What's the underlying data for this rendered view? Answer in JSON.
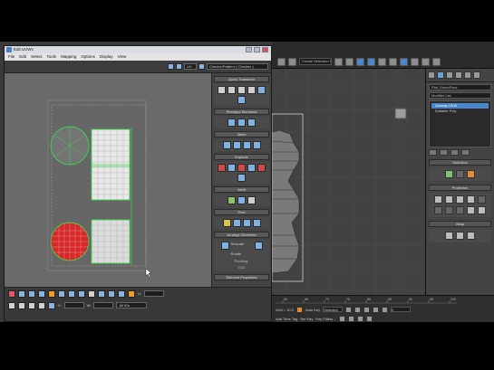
{
  "uvw_editor": {
    "title": "Edit UVWs",
    "menu": [
      "File",
      "Edit",
      "Select",
      "Tools",
      "Mapping",
      "Options",
      "Display",
      "View"
    ],
    "toolbar": {
      "uv_dropdown": "UV",
      "checker_dropdown": "CheckerPattern ( Checker )"
    },
    "rollouts": [
      {
        "id": "quick",
        "title": "Quick Transform"
      },
      {
        "id": "reshape",
        "title": "Reshape Elements"
      },
      {
        "id": "stitch",
        "title": "Stitch"
      },
      {
        "id": "explode",
        "title": "Explode"
      },
      {
        "id": "weld",
        "title": "Weld"
      },
      {
        "id": "peel",
        "title": "Peel"
      },
      {
        "id": "arrange",
        "title": "Arrange Elements",
        "checks": [
          "Rescale",
          "Rotate"
        ],
        "padding_label": "Padding:",
        "padding_value": "0.02"
      },
      {
        "id": "elprops",
        "title": "Element Properties"
      }
    ],
    "bottom": {
      "u_label": "U:",
      "v_label": "V:",
      "w_label": "W:",
      "u_value": "",
      "v_value": "",
      "w_value": "",
      "filter_label": "All IDs"
    }
  },
  "max": {
    "toolbar_dropdown": "Create Selection Se",
    "viewport_label": "",
    "command_panel": {
      "object_name": "Plat_StoneFloor",
      "modifier_list": "Modifier List",
      "stack": [
        {
          "label": "Unwrap UVW",
          "selected": true
        },
        {
          "label": "Editable Poly",
          "selected": false
        }
      ],
      "rollouts": [
        "Selection",
        "Projection",
        "Wrap"
      ]
    },
    "status": {
      "grid_label": "Grid = 10.0",
      "selected_label": "Selected",
      "autokey_label": "Auto Key",
      "setkey_label": "Set Key",
      "keyfilters_label": "Key Filters...",
      "add_time_tag": "Add Time Tag",
      "frame_value": "0"
    },
    "timeline": {
      "ticks": [
        "60",
        "65",
        "70",
        "75",
        "80",
        "85",
        "90",
        "95",
        "100"
      ]
    }
  },
  "colors": {
    "uv_shell_green": "#3fd64a",
    "uv_selected_red": "#d62828",
    "uv_grid_white": "#f2f2f2",
    "max_accent": "#4a86c8"
  }
}
